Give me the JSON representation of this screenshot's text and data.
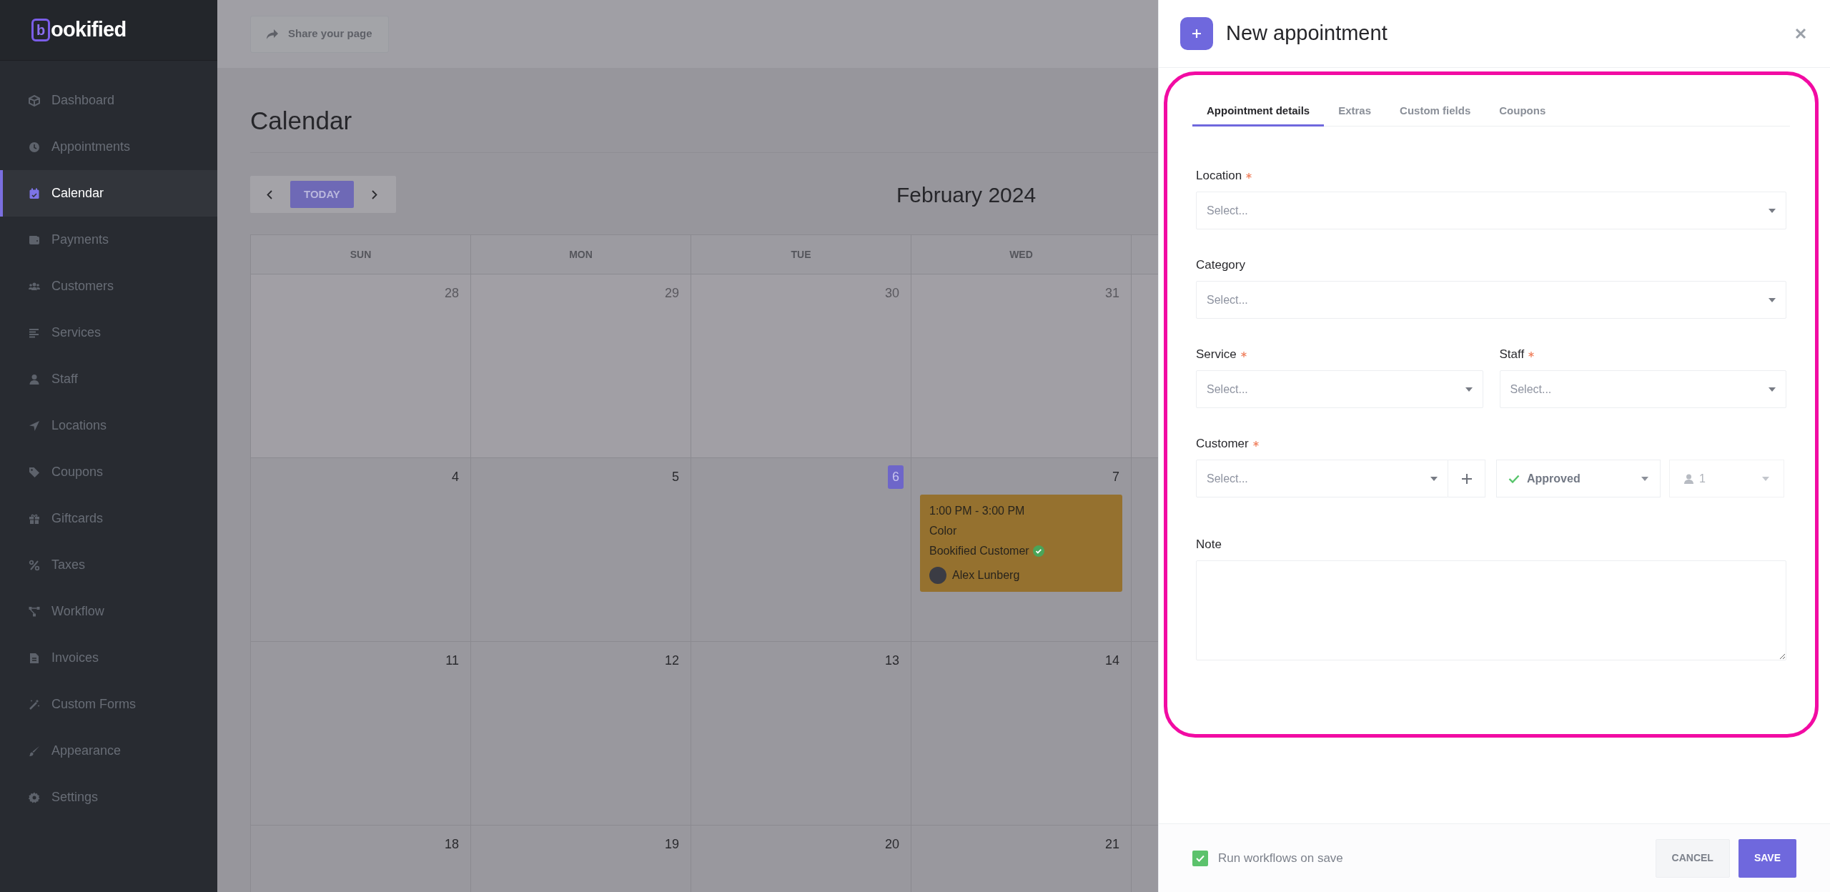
{
  "sidebar": {
    "logo": {
      "mark": "b",
      "text": "ookified"
    },
    "items": [
      {
        "label": "Dashboard",
        "selected": false
      },
      {
        "label": "Appointments",
        "selected": false
      },
      {
        "label": "Calendar",
        "selected": true
      },
      {
        "label": "Payments",
        "selected": false
      },
      {
        "label": "Customers",
        "selected": false
      },
      {
        "label": "Services",
        "selected": false
      },
      {
        "label": "Staff",
        "selected": false
      },
      {
        "label": "Locations",
        "selected": false
      },
      {
        "label": "Coupons",
        "selected": false
      },
      {
        "label": "Giftcards",
        "selected": false
      },
      {
        "label": "Taxes",
        "selected": false
      },
      {
        "label": "Workflow",
        "selected": false
      },
      {
        "label": "Invoices",
        "selected": false
      },
      {
        "label": "Custom Forms",
        "selected": false
      },
      {
        "label": "Appearance",
        "selected": false
      },
      {
        "label": "Settings",
        "selected": false
      }
    ]
  },
  "topbar": {
    "share_button": "Share your page"
  },
  "page_title": "Calendar",
  "calendar": {
    "today_button": "TODAY",
    "month": "February 2024",
    "weekdays": [
      "SUN",
      "MON",
      "TUE",
      "WED"
    ],
    "weeks": [
      {
        "days": [
          {
            "date": "28",
            "outside": true,
            "today": false
          },
          {
            "date": "29",
            "outside": true,
            "today": false
          },
          {
            "date": "30",
            "outside": true,
            "today": false
          },
          {
            "date": "31",
            "outside": true,
            "today": false
          }
        ]
      },
      {
        "days": [
          {
            "date": "4",
            "outside": false,
            "today": false
          },
          {
            "date": "5",
            "outside": false,
            "today": false
          },
          {
            "date": "6",
            "outside": false,
            "today": true
          },
          {
            "date": "7",
            "outside": false,
            "today": false,
            "events": [
              {
                "time": "1:00 PM - 3:00 PM",
                "service": "Color",
                "customer": "Bookified Customer",
                "approved": true,
                "staff": "Alex Lunberg"
              }
            ]
          }
        ]
      },
      {
        "days": [
          {
            "date": "11",
            "outside": false,
            "today": false
          },
          {
            "date": "12",
            "outside": false,
            "today": false
          },
          {
            "date": "13",
            "outside": false,
            "today": false
          },
          {
            "date": "14",
            "outside": false,
            "today": false
          }
        ]
      },
      {
        "days": [
          {
            "date": "18",
            "outside": false,
            "today": false
          },
          {
            "date": "19",
            "outside": false,
            "today": false
          },
          {
            "date": "20",
            "outside": false,
            "today": false
          },
          {
            "date": "21",
            "outside": false,
            "today": false
          }
        ]
      }
    ]
  },
  "panel": {
    "title": "New appointment",
    "tabs": [
      {
        "label": "Appointment details",
        "selected": true
      },
      {
        "label": "Extras",
        "selected": false
      },
      {
        "label": "Custom fields",
        "selected": false
      },
      {
        "label": "Coupons",
        "selected": false
      }
    ],
    "highlighted": true,
    "rows": [
      {
        "fields": [
          {
            "label": "Location",
            "required": true,
            "placeholder": "Select..."
          }
        ]
      },
      {
        "fields": [
          {
            "label": "Category",
            "required": false,
            "placeholder": "Select..."
          }
        ]
      },
      {
        "fields": [
          {
            "label": "Service",
            "required": true,
            "placeholder": "Select..."
          },
          {
            "label": "Staff",
            "required": true,
            "placeholder": "Select..."
          }
        ]
      }
    ],
    "customer": {
      "label": "Customer",
      "required": true,
      "placeholder": "Select...",
      "status": "Approved",
      "people": "1"
    },
    "note": {
      "label": "Note"
    },
    "footer": {
      "run_workflows": {
        "label": "Run workflows on save",
        "checked": true
      },
      "cancel": "CANCEL",
      "save": "SAVE"
    }
  }
}
